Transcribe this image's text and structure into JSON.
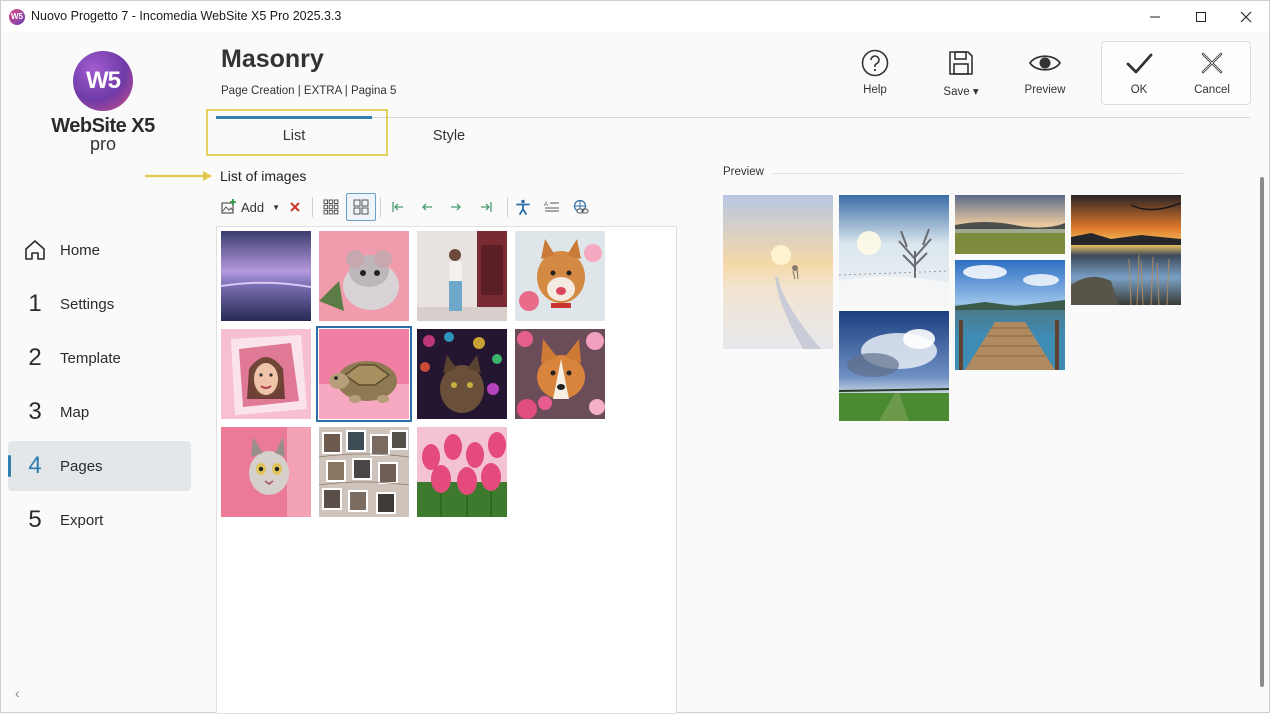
{
  "window": {
    "title": "Nuovo Progetto 7 - Incomedia WebSite X5 Pro 2025.3.3",
    "app_icon_text": "W5"
  },
  "logo": {
    "mark": "W5",
    "name": "WebSite X5",
    "edition": "pro"
  },
  "nav": {
    "items": [
      {
        "num": "",
        "label": "Home",
        "icon": "home-icon"
      },
      {
        "num": "1",
        "label": "Settings"
      },
      {
        "num": "2",
        "label": "Template"
      },
      {
        "num": "3",
        "label": "Map"
      },
      {
        "num": "4",
        "label": "Pages",
        "active": true
      },
      {
        "num": "5",
        "label": "Export"
      }
    ],
    "collapse": "‹"
  },
  "header": {
    "title": "Masonry",
    "breadcrumb": "Page Creation | EXTRA | Pagina 5"
  },
  "toolbar": {
    "help": "Help",
    "save": "Save ▾",
    "preview": "Preview",
    "ok": "OK",
    "cancel": "Cancel"
  },
  "tabs": [
    {
      "label": "List",
      "active": true
    },
    {
      "label": "Style"
    }
  ],
  "list": {
    "heading": "List of images",
    "add_label": "Add",
    "thumbnails": [
      "purple-sea-sunset",
      "mouse-on-pink",
      "woman-in-doorway",
      "shiba-inu-flowers",
      "woman-breaking-paper",
      "tortoise-on-pink",
      "cat-with-bokeh-lights",
      "corgi-in-flowers",
      "cat-peeking-pink-wall",
      "polaroid-wall",
      "pink-tulips"
    ],
    "selected_index": 5
  },
  "preview": {
    "label": "Preview",
    "images": [
      "snowy-road-sunrise",
      "frosted-tree",
      "meadow-lake-sunset",
      "lake-reeds-sunset",
      "wooden-pier-lake",
      "cloudy-sky-field"
    ]
  },
  "colors": {
    "accent": "#2f7fb1",
    "highlight": "#e6cf5a",
    "delete": "#d0362c"
  }
}
